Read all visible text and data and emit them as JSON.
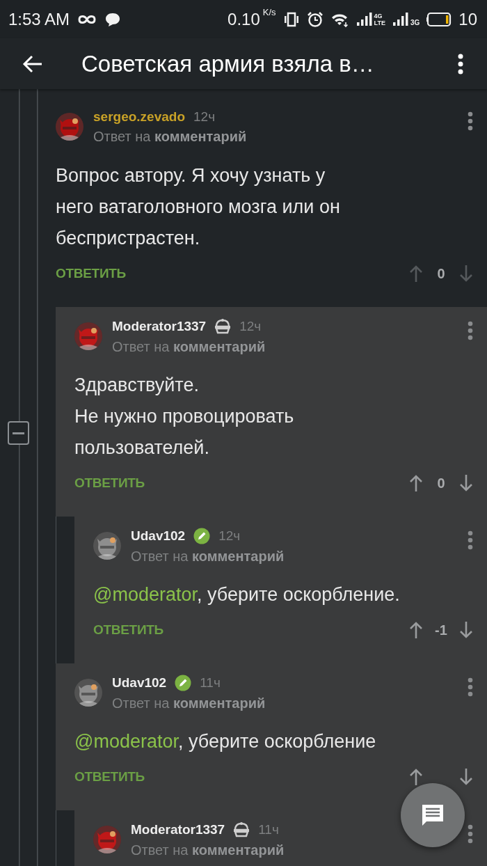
{
  "status_bar": {
    "time": "1:53 AM",
    "net_speed": "0.10",
    "net_unit": "K/s",
    "sim1_top": "4G",
    "sim1_bottom": "LTE",
    "sim2": "3G",
    "battery": "10"
  },
  "app_bar": {
    "title": "Советская армия взяла в…"
  },
  "comments": [
    {
      "author": "sergeo.zevado",
      "color": "#c9a227",
      "avatar": {
        "kind": "picture",
        "color": "#b01010"
      },
      "time": "12ч",
      "reply_to": "Ответ на **комментарий**",
      "text": "Вопрос автору. Я хочу узнать у\nнего ватаголовного мозга или он\nбеспристрастен.",
      "reply_label": "ОТВЕТИТЬ",
      "score": "0",
      "votes_active": false,
      "children": [
        {
          "author": "Moderator1337",
          "color": "#eeeeee",
          "badge": {
            "kind": "moderator"
          },
          "avatar": {
            "kind": "picture",
            "color": "#c01818"
          },
          "time": "12ч",
          "reply_to": "Ответ на **комментарий**",
          "text": "Здравствуйте.\nНе нужно провоцировать\nпользователей.",
          "reply_label": "ОТВЕТИТЬ",
          "score": "0",
          "votes_active": true,
          "children": [
            {
              "author": "Udav102",
              "color": "#eeeeee",
              "badge": {
                "kind": "editor"
              },
              "avatar": {
                "kind": "picture",
                "color": "#8e8e8e"
              },
              "time": "12ч",
              "reply_to": "Ответ на **комментарий**",
              "mention": "@moderator",
              "text": ", уберите оскорбление.",
              "reply_label": "ОТВЕТИТЬ",
              "score": "-1",
              "votes_active": true
            }
          ]
        },
        {
          "author": "Udav102",
          "color": "#eeeeee",
          "badge": {
            "kind": "editor"
          },
          "avatar": {
            "kind": "picture",
            "color": "#8e8e8e"
          },
          "time": "11ч",
          "reply_to": "Ответ на **комментарий**",
          "mention": "@moderator",
          "text": ", уберите оскорбление",
          "reply_label": "ОТВЕТИТЬ",
          "votes_active": true,
          "children": [
            {
              "author": "Moderator1337",
              "color": "#eeeeee",
              "badge": {
                "kind": "moderator"
              },
              "avatar": {
                "kind": "picture",
                "color": "#c01818"
              },
              "time": "11ч",
              "reply_to": "Ответ на **комментарий**"
            }
          ]
        }
      ]
    }
  ]
}
